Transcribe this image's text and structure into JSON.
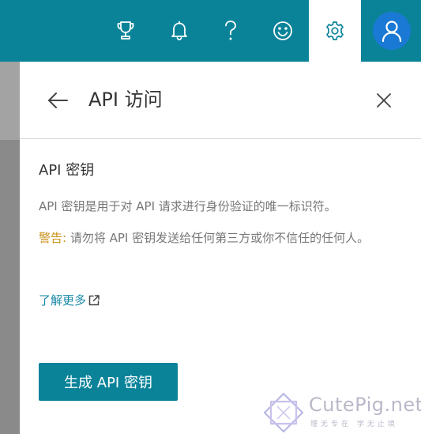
{
  "topbar": {
    "icons": [
      {
        "name": "trophy-icon"
      },
      {
        "name": "bell-icon"
      },
      {
        "name": "help-icon"
      },
      {
        "name": "smiley-icon"
      },
      {
        "name": "gear-icon",
        "active": true
      },
      {
        "name": "user-icon"
      }
    ],
    "bg_color": "#0a8399",
    "avatar_color": "#1a79d4"
  },
  "panel": {
    "title": "API 访问",
    "section_title": "API 密钥",
    "description": "API 密钥是用于对 API 请求进行身份验证的唯一标识符。",
    "warning_label": "警告:",
    "warning_text": " 请勿将 API 密钥发送给任何第三方或你不信任的任何人。",
    "learn_more": "了解更多",
    "generate_button": "生成 API 密钥"
  },
  "watermark": {
    "text": "CutePig.net",
    "subtext": "理无专在 学无止境"
  },
  "colors": {
    "accent": "#0a8399",
    "warning": "#c8901a",
    "link": "#1a8aa8"
  }
}
